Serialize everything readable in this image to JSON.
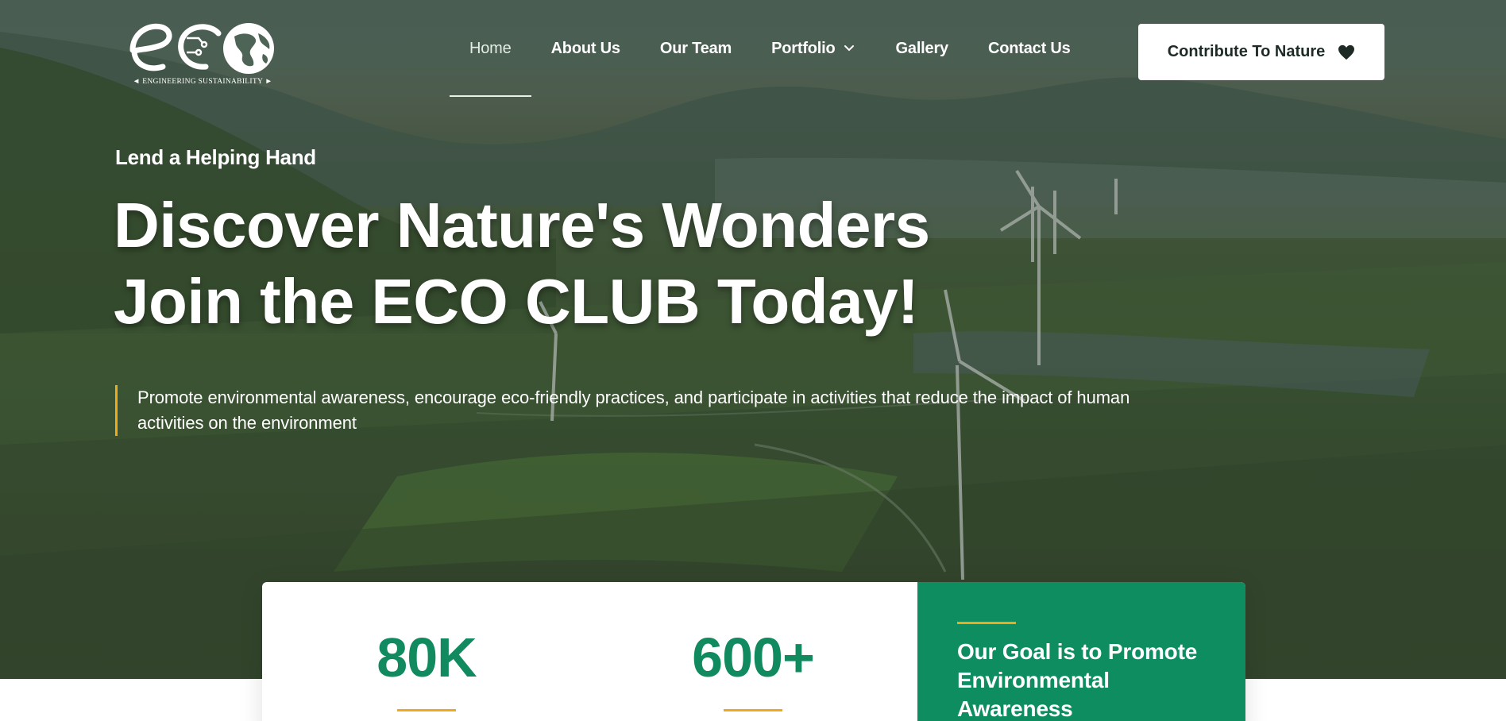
{
  "header": {
    "logo": {
      "alt": "eco",
      "tagline": "ENGINEERING SUSTAINABILITY"
    },
    "nav": [
      {
        "label": "Home",
        "active": true
      },
      {
        "label": "About Us",
        "active": false
      },
      {
        "label": "Our Team",
        "active": false
      },
      {
        "label": "Portfolio",
        "active": false,
        "has_dropdown": true
      },
      {
        "label": "Gallery",
        "active": false
      },
      {
        "label": "Contact Us",
        "active": false
      }
    ],
    "cta": {
      "label": "Contribute To Nature",
      "icon": "heart-icon"
    }
  },
  "hero": {
    "eyebrow": "Lend a Helping Hand",
    "headline_line1": "Discover Nature's Wonders",
    "headline_line2": "Join the ECO CLUB Today!",
    "lead": "Promote environmental awareness, encourage eco-friendly practices, and participate in activities that reduce the impact of human activities on the environment"
  },
  "stats": [
    {
      "value": "80K"
    },
    {
      "value": "600+"
    }
  ],
  "goal": {
    "text": "Our Goal is to Promote Environmental Awareness"
  },
  "colors": {
    "brand_green": "#0e8d61",
    "accent_yellow": "#f0a81c",
    "text_dark": "#1d2b24"
  }
}
